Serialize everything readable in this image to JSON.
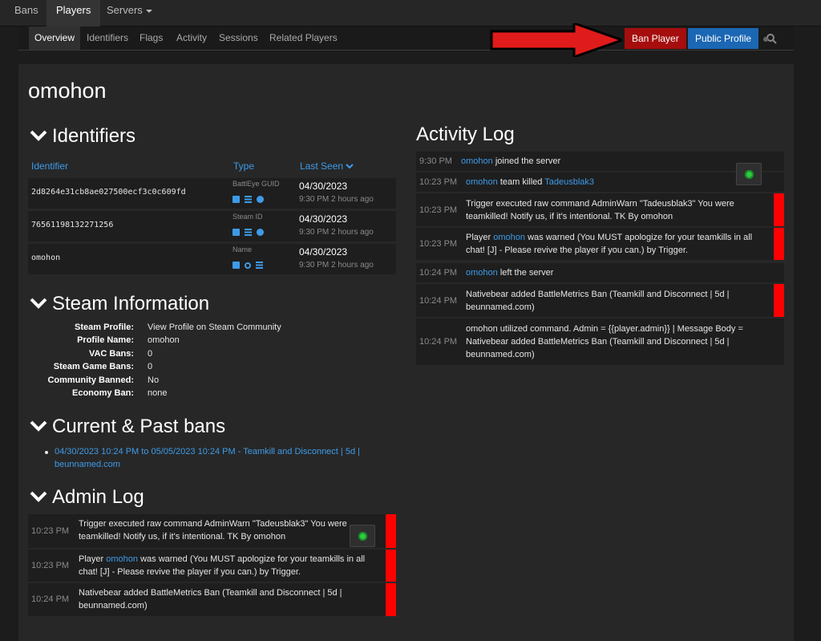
{
  "topnav": {
    "bans": "Bans",
    "players": "Players",
    "servers": "Servers"
  },
  "subnav": {
    "tabs": [
      "Overview",
      "Identifiers",
      "Flags",
      "Activity",
      "Sessions",
      "Related Players"
    ],
    "ban_button": "Ban Player",
    "public_profile_button": "Public Profile"
  },
  "player": {
    "name": "omohon"
  },
  "identifiers": {
    "title": "Identifiers",
    "headers": {
      "identifier": "Identifier",
      "type": "Type",
      "last_seen": "Last Seen"
    },
    "rows": [
      {
        "value": "2d8264e31cb8ae027500ecf3c0c609fd",
        "type": "BattlEye GUID",
        "date": "04/30/2023",
        "ago": "9:30 PM 2 hours ago"
      },
      {
        "value": "76561198132271256",
        "type": "Steam ID",
        "date": "04/30/2023",
        "ago": "9:30 PM 2 hours ago"
      },
      {
        "value": "omohon",
        "type": "Name",
        "date": "04/30/2023",
        "ago": "9:30 PM 2 hours ago"
      }
    ]
  },
  "steam": {
    "title": "Steam Information",
    "fields": [
      {
        "key": "Steam Profile:",
        "value": "View Profile on Steam Community"
      },
      {
        "key": "Profile Name:",
        "value": "omohon"
      },
      {
        "key": "VAC Bans:",
        "value": "0"
      },
      {
        "key": "Steam Game Bans:",
        "value": "0"
      },
      {
        "key": "Community Banned:",
        "value": "No"
      },
      {
        "key": "Economy Ban:",
        "value": "none"
      }
    ]
  },
  "bans": {
    "title": "Current & Past bans",
    "items": [
      "04/30/2023 10:24 PM to 05/05/2023 10:24 PM - Teamkill and Disconnect | 5d | beunnamed.com"
    ]
  },
  "admin_log": {
    "title": "Admin Log",
    "rows": [
      {
        "time": "10:23 PM",
        "text": "Trigger executed raw command AdminWarn \"Tadeusblak3\" You were teamkilled! Notify us, if it's intentional. TK By omohon"
      },
      {
        "time": "10:23 PM",
        "pre": "Player ",
        "link": "omohon",
        "post": " was warned (You MUST apologize for your teamkills in all chat! [J] - Please revive the player if you can.) by Trigger."
      },
      {
        "time": "10:24 PM",
        "text": "Nativebear added BattleMetrics Ban (Teamkill and Disconnect | 5d | beunnamed.com)"
      }
    ]
  },
  "activity_log": {
    "title": "Activity Log",
    "rows": [
      {
        "time": "9:30 PM",
        "link": "omohon",
        "post": " joined the server"
      },
      {
        "time": "10:23 PM",
        "link": "omohon",
        "post": " team killed ",
        "link2": "Tadeusblak3"
      },
      {
        "time": "10:23 PM",
        "text": "Trigger executed raw command AdminWarn \"Tadeusblak3\" You were teamkilled! Notify us, if it's intentional. TK By omohon"
      },
      {
        "time": "10:23 PM",
        "pre": "Player ",
        "link": "omohon",
        "post": " was warned (You MUST apologize for your teamkills in all chat! [J] - Please revive the player if you can.) by Trigger."
      },
      {
        "time": "10:24 PM",
        "link": "omohon",
        "post": " left the server"
      },
      {
        "time": "10:24 PM",
        "text": "Nativebear added BattleMetrics Ban (Teamkill and Disconnect | 5d | beunnamed.com)"
      },
      {
        "time": "10:24 PM",
        "text": "omohon utilized command. Admin = {{player.admin}} | Message Body = Nativebear added BattleMetrics Ban (Teamkill and Disconnect | 5d | beunnamed.com)"
      }
    ]
  },
  "colors": {
    "accent": "#3d9be9",
    "danger": "#a60d0d",
    "primary": "#1b67b3",
    "flag": "#ff0000",
    "gear": "#2ecc40"
  }
}
